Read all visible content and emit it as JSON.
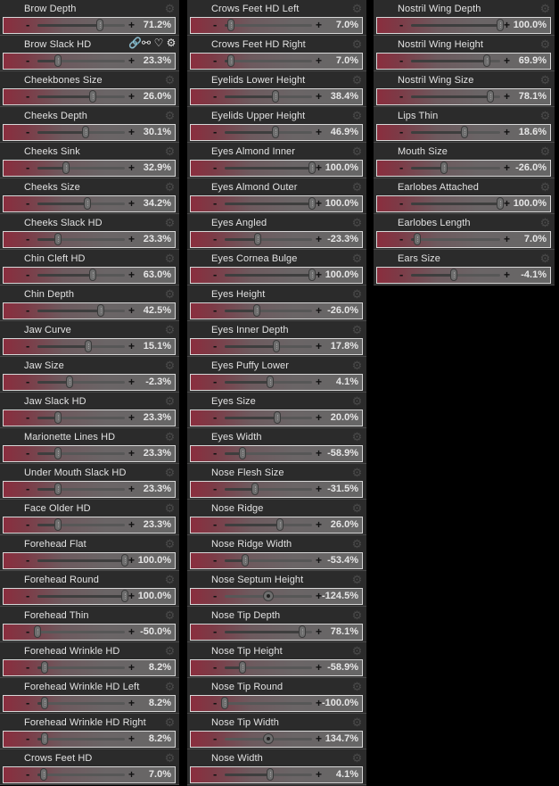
{
  "columns": [
    {
      "items": [
        {
          "label": "Brow Depth",
          "value": "71.2%",
          "pos": 0.712
        },
        {
          "label": "Brow Slack HD",
          "value": "23.3%",
          "pos": 0.233,
          "active": true
        },
        {
          "label": "Cheekbones Size",
          "value": "26.0%",
          "pos": 0.63
        },
        {
          "label": "Cheeks Depth",
          "value": "30.1%",
          "pos": 0.55
        },
        {
          "label": "Cheeks Sink",
          "value": "32.9%",
          "pos": 0.329
        },
        {
          "label": "Cheeks Size",
          "value": "34.2%",
          "pos": 0.57
        },
        {
          "label": "Cheeks Slack HD",
          "value": "23.3%",
          "pos": 0.233
        },
        {
          "label": "Chin Cleft HD",
          "value": "63.0%",
          "pos": 0.63
        },
        {
          "label": "Chin Depth",
          "value": "42.5%",
          "pos": 0.72
        },
        {
          "label": "Jaw Curve",
          "value": "15.1%",
          "pos": 0.58
        },
        {
          "label": "Jaw Size",
          "value": "-2.3%",
          "pos": 0.37
        },
        {
          "label": "Jaw Slack HD",
          "value": "23.3%",
          "pos": 0.233
        },
        {
          "label": "Marionette Lines HD",
          "value": "23.3%",
          "pos": 0.233
        },
        {
          "label": "Under Mouth Slack HD",
          "value": "23.3%",
          "pos": 0.233
        },
        {
          "label": "Face Older HD",
          "value": "23.3%",
          "pos": 0.233
        },
        {
          "label": "Forehead Flat",
          "value": "100.0%",
          "pos": 1.0
        },
        {
          "label": "Forehead Round",
          "value": "100.0%",
          "pos": 1.0
        },
        {
          "label": "Forehead Thin",
          "value": "-50.0%",
          "pos": 0.0
        },
        {
          "label": "Forehead Wrinkle HD",
          "value": "8.2%",
          "pos": 0.082
        },
        {
          "label": "Forehead Wrinkle HD Left",
          "value": "8.2%",
          "pos": 0.082
        },
        {
          "label": "Forehead Wrinkle HD Right",
          "value": "8.2%",
          "pos": 0.082
        },
        {
          "label": "Crows Feet HD",
          "value": "7.0%",
          "pos": 0.07
        }
      ]
    },
    {
      "items": [
        {
          "label": "Crows Feet HD Left",
          "value": "7.0%",
          "pos": 0.07
        },
        {
          "label": "Crows Feet HD Right",
          "value": "7.0%",
          "pos": 0.07
        },
        {
          "label": "Eyelids Lower Height",
          "value": "38.4%",
          "pos": 0.58
        },
        {
          "label": "Eyelids Upper Height",
          "value": "46.9%",
          "pos": 0.58
        },
        {
          "label": "Eyes Almond Inner",
          "value": "100.0%",
          "pos": 1.0
        },
        {
          "label": "Eyes Almond Outer",
          "value": "100.0%",
          "pos": 1.0
        },
        {
          "label": "Eyes Angled",
          "value": "-23.3%",
          "pos": 0.38
        },
        {
          "label": "Eyes Cornea Bulge",
          "value": "100.0%",
          "pos": 1.0
        },
        {
          "label": "Eyes Height",
          "value": "-26.0%",
          "pos": 0.37
        },
        {
          "label": "Eyes Inner Depth",
          "value": "17.8%",
          "pos": 0.59
        },
        {
          "label": "Eyes Puffy Lower",
          "value": "4.1%",
          "pos": 0.52
        },
        {
          "label": "Eyes Size",
          "value": "20.0%",
          "pos": 0.6
        },
        {
          "label": "Eyes Width",
          "value": "-58.9%",
          "pos": 0.205
        },
        {
          "label": "Nose Flesh Size",
          "value": "-31.5%",
          "pos": 0.342
        },
        {
          "label": "Nose Ridge",
          "value": "26.0%",
          "pos": 0.63
        },
        {
          "label": "Nose Ridge Width",
          "value": "-53.4%",
          "pos": 0.233
        },
        {
          "label": "Nose Septum Height",
          "value": "-124.5%",
          "pos": 0.5,
          "round": true
        },
        {
          "label": "Nose Tip Depth",
          "value": "78.1%",
          "pos": 0.89
        },
        {
          "label": "Nose Tip Height",
          "value": "-58.9%",
          "pos": 0.205
        },
        {
          "label": "Nose Tip Round",
          "value": "-100.0%",
          "pos": 0.0
        },
        {
          "label": "Nose Tip Width",
          "value": "134.7%",
          "pos": 0.5,
          "round": true
        },
        {
          "label": "Nose Width",
          "value": "4.1%",
          "pos": 0.52
        }
      ]
    },
    {
      "items": [
        {
          "label": "Nostril Wing Depth",
          "value": "100.0%",
          "pos": 1.0
        },
        {
          "label": "Nostril Wing Height",
          "value": "69.9%",
          "pos": 0.85
        },
        {
          "label": "Nostril Wing Size",
          "value": "78.1%",
          "pos": 0.89
        },
        {
          "label": "Lips Thin",
          "value": "18.6%",
          "pos": 0.6
        },
        {
          "label": "Mouth Size",
          "value": "-26.0%",
          "pos": 0.37
        },
        {
          "label": "Earlobes Attached",
          "value": "100.0%",
          "pos": 1.0
        },
        {
          "label": "Earlobes Length",
          "value": "7.0%",
          "pos": 0.07
        },
        {
          "label": "Ears Size",
          "value": "-4.1%",
          "pos": 0.48
        }
      ]
    }
  ],
  "icons": {
    "gear": "⚙",
    "active_icons": [
      "link-icon",
      "unlink-icon",
      "heart-icon",
      "gear-icon"
    ],
    "active_glyphs": [
      "🔗",
      "⚯",
      "♡",
      "⚙"
    ]
  },
  "colors": {
    "slider_accent": "#8a2e3e",
    "panel_bg": "#2b2b2b",
    "text": "#e2e2e2"
  }
}
